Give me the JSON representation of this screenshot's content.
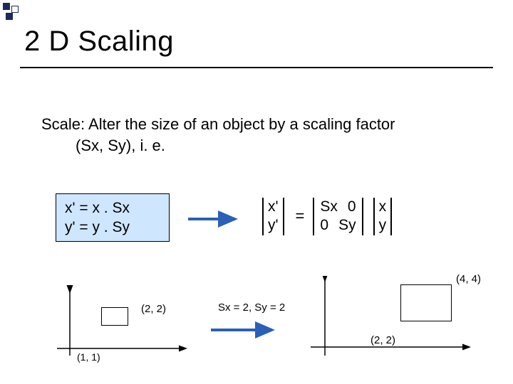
{
  "title": "2 D Scaling",
  "description": {
    "line1": "Scale:  Alter the size of an object by a scaling factor",
    "line2": "(Sx, Sy), i. e."
  },
  "equations": {
    "xprime": "x' = x . Sx",
    "yprime": "y' = y . Sy"
  },
  "matrix": {
    "lhs": {
      "r1": "x'",
      "r2": "y'"
    },
    "m": {
      "r1c1": "Sx",
      "r1c2": "0",
      "r2c1": "0",
      "r2c2": "Sy"
    },
    "rhs": {
      "r1": "x",
      "r2": "y"
    },
    "eq": "="
  },
  "example": {
    "before_label": "(2, 2)",
    "origin_label_before": "(1, 1)",
    "after_label": "(4, 4)",
    "origin_label_after": "(2, 2)",
    "scale_note": "Sx = 2, Sy = 2"
  }
}
